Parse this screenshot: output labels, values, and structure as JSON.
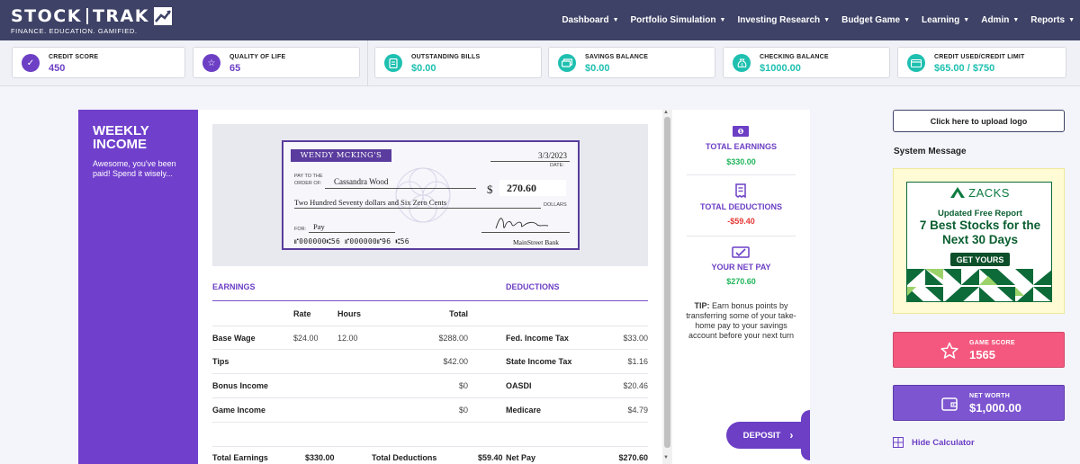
{
  "brand": {
    "name_left": "STOCK",
    "name_right": "TRAK",
    "tagline": "FINANCE. EDUCATION. GAMIFIED."
  },
  "nav": {
    "items": [
      {
        "label": "Dashboard"
      },
      {
        "label": "Portfolio Simulation"
      },
      {
        "label": "Investing Research"
      },
      {
        "label": "Budget Game"
      },
      {
        "label": "Learning"
      },
      {
        "label": "Admin"
      },
      {
        "label": "Reports"
      }
    ]
  },
  "stats": [
    {
      "label": "CREDIT SCORE",
      "value": "450",
      "icon": "check-circle-icon"
    },
    {
      "label": "QUALITY OF LIFE",
      "value": "65",
      "icon": "star-icon"
    },
    {
      "label": "OUTSTANDING BILLS",
      "value": "$0.00",
      "icon": "bill-icon"
    },
    {
      "label": "SAVINGS BALANCE",
      "value": "$0.00",
      "icon": "money-stack-icon"
    },
    {
      "label": "CHECKING BALANCE",
      "value": "$1000.00",
      "icon": "money-bag-icon"
    },
    {
      "label": "CREDIT USED/CREDIT LIMIT",
      "value": "$65.00 / $750",
      "icon": "credit-card-icon"
    }
  ],
  "weekly": {
    "title": "WEEKLY INCOME",
    "subtitle": "Awesome, you've been paid! Spend it wisely..."
  },
  "check": {
    "account_name": "WENDY MCKING'S",
    "date": "3/3/2023",
    "date_label": "DATE:",
    "pay_label": "PAY TO THE\nORDER OF:",
    "payee": "Cassandra Wood",
    "currency": "$",
    "amount": "270.60",
    "amount_words": "Two Hundred Seventy dollars and Six Zero Cents",
    "dollars_label": "DOLLARS",
    "for_label": "FOR:",
    "memo": "Pay",
    "micr": "⑈000000⑆56   ⑈000000⑈96   ⑆56",
    "bank": "MainStreet Bank"
  },
  "table": {
    "earnings_label": "EARNINGS",
    "deductions_label": "DEDUCTIONS",
    "headers": {
      "rate": "Rate",
      "hours": "Hours",
      "total": "Total"
    },
    "earnings": [
      {
        "name": "Base Wage",
        "rate": "$24.00",
        "hours": "12.00",
        "total": "$288.00"
      },
      {
        "name": "Tips",
        "rate": "",
        "hours": "",
        "total": "$42.00"
      },
      {
        "name": "Bonus Income",
        "rate": "",
        "hours": "",
        "total": "$0"
      },
      {
        "name": "Game Income",
        "rate": "",
        "hours": "",
        "total": "$0"
      }
    ],
    "deductions": [
      {
        "name": "Fed. Income Tax",
        "amount": "$33.00"
      },
      {
        "name": "State Income Tax",
        "amount": "$1.16"
      },
      {
        "name": "OASDI",
        "amount": "$20.46"
      },
      {
        "name": "Medicare",
        "amount": "$4.79"
      }
    ],
    "totals": {
      "earnings_label": "Total Earnings",
      "earnings_value": "$330.00",
      "deductions_label": "Total Deductions",
      "deductions_value": "$59.40",
      "net_label": "Net Pay",
      "net_value": "$270.60"
    }
  },
  "summary": {
    "total_earnings_label": "TOTAL EARNINGS",
    "total_earnings": "$330.00",
    "total_deductions_label": "TOTAL DEDUCTIONS",
    "total_deductions": "-$59.40",
    "net_pay_label": "YOUR NET PAY",
    "net_pay": "$270.60",
    "tip_bold": "TIP:",
    "tip_text": " Earn bonus points by transferring some of your take-home pay to your savings account before your next turn"
  },
  "deposit_label": "DEPOSIT",
  "sidebar": {
    "upload_label": "Click here to upload logo",
    "system_message": "System Message",
    "ad": {
      "brand": "ZACKS",
      "sub": "Updated Free Report",
      "headline": "7 Best Stocks for the Next 30 Days",
      "cta": "GET YOURS"
    },
    "game_score_label": "GAME SCORE",
    "game_score": "1565",
    "net_worth_label": "NET WORTH",
    "net_worth": "$1,000.00",
    "hide_calc": "Hide Calculator"
  },
  "colors": {
    "nav": "#3e4266",
    "accent": "#6c3fc5",
    "teal": "#1fc0b0",
    "score": "#f4587e",
    "worth": "#7d55d0",
    "negative": "#e53935",
    "positive": "#1fb45a"
  }
}
